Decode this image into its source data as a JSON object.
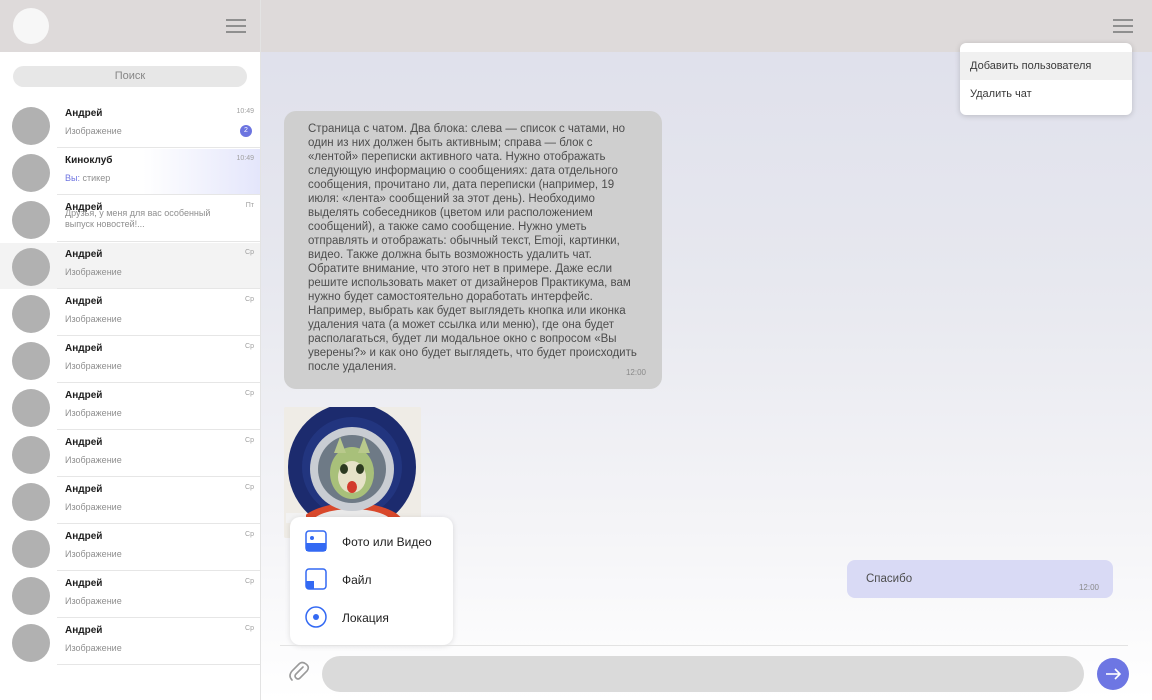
{
  "sidebar": {
    "search": {
      "placeholder": "Поиск"
    },
    "chats": [
      {
        "name": "Андрей",
        "preview": "Изображение",
        "time": "10:49",
        "badge": "2"
      },
      {
        "name": "Киноклуб",
        "you_prefix": "Вы:",
        "preview": "стикер",
        "time": "10:49"
      },
      {
        "name": "Андрей",
        "preview": "Друзья, у меня для вас особенный выпуск новостей!...",
        "time": "Пт"
      },
      {
        "name": "Андрей",
        "preview": "Изображение",
        "time": "Ср"
      },
      {
        "name": "Андрей",
        "preview": "Изображение",
        "time": "Ср"
      },
      {
        "name": "Андрей",
        "preview": "Изображение",
        "time": "Ср"
      },
      {
        "name": "Андрей",
        "preview": "Изображение",
        "time": "Ср"
      },
      {
        "name": "Андрей",
        "preview": "Изображение",
        "time": "Ср"
      },
      {
        "name": "Андрей",
        "preview": "Изображение",
        "time": "Ср"
      },
      {
        "name": "Андрей",
        "preview": "Изображение",
        "time": "Ср"
      },
      {
        "name": "Андрей",
        "preview": "Изображение",
        "time": "Ср"
      },
      {
        "name": "Андрей",
        "preview": "Изображение",
        "time": "Ср"
      }
    ]
  },
  "header_menu": {
    "items": [
      "Добавить пользователя",
      "Удалить чат"
    ]
  },
  "messages": {
    "incoming": {
      "text": "Страница с чатом. Два блока: слева — список с чатами, но один из них должен быть активным; справа — блок с «лентой» переписки активного чата. Нужно отображать следующую информацию о сообщениях: дата отдельного сообщения, прочитано ли, дата переписки (например, 19 июля: «лента» сообщений за этот день). Необходимо выделять собеседников (цветом или расположением сообщений), а также само сообщение. Нужно уметь отправлять и отображать: обычный текст, Emoji, картинки, видео. Также должна быть возможность удалить чат. Обратите внимание, что этого нет в примере. Даже если решите использовать макет от дизайнеров Практикума, вам нужно будет самостоятельно доработать интерфейс. Например, выбрать как будет выглядеть кнопка или иконка удаления чата (а может ссылка или меню), где она будет располагаться, будет ли модальное окно с вопросом «Вы уверены?» и как оно будет выглядеть, что будет происходить после удаления.",
      "time": "12:00"
    },
    "image": {
      "icon": "astronaut-cat-image"
    },
    "outgoing": {
      "text": "Спасибо",
      "time": "12:00"
    }
  },
  "attach_menu": {
    "items": [
      {
        "label": "Фото или Видео",
        "icon": "photo-icon"
      },
      {
        "label": "Файл",
        "icon": "file-icon"
      },
      {
        "label": "Локация",
        "icon": "location-icon"
      }
    ]
  },
  "colors": {
    "accent": "#6d76e3",
    "header_bg": "#dedada",
    "incoming_bubble": "#cfcfcf",
    "outgoing_bubble": "#d9daf5"
  }
}
